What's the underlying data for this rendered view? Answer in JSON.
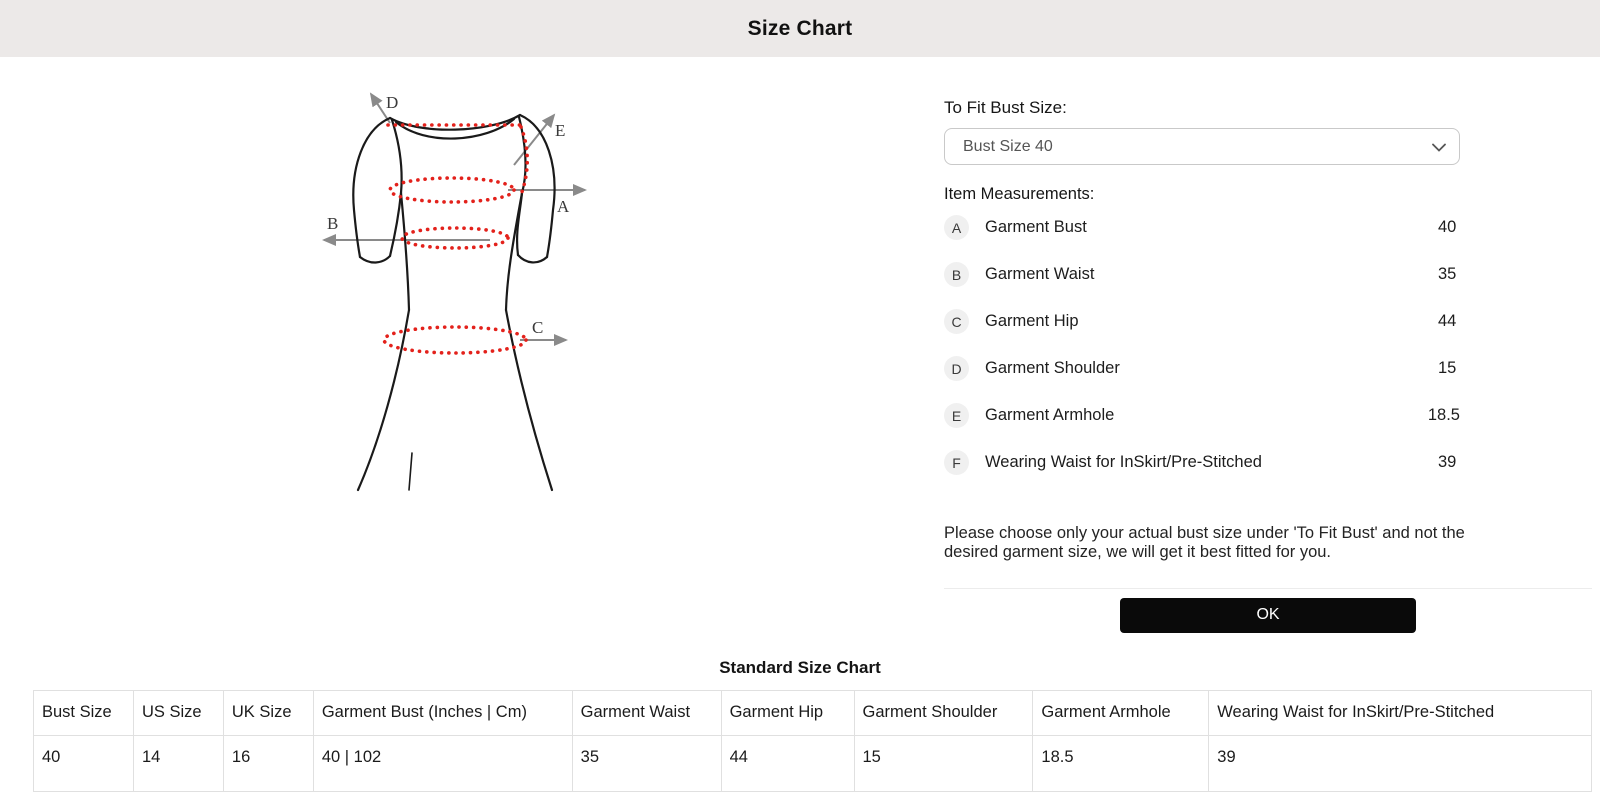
{
  "header": {
    "title": "Size Chart"
  },
  "panel": {
    "to_fit_label": "To Fit Bust Size:",
    "bust_select": {
      "selected": "Bust Size 40"
    },
    "item_measurements_label": "Item Measurements:",
    "measurements": [
      {
        "key": "A",
        "label": "Garment Bust",
        "value": "40"
      },
      {
        "key": "B",
        "label": "Garment Waist",
        "value": "35"
      },
      {
        "key": "C",
        "label": "Garment Hip",
        "value": "44"
      },
      {
        "key": "D",
        "label": "Garment Shoulder",
        "value": "15"
      },
      {
        "key": "E",
        "label": "Garment Armhole",
        "value": "18.5"
      },
      {
        "key": "F",
        "label": "Wearing Waist for InSkirt/Pre-Stitched",
        "value": "39"
      }
    ],
    "note": "Please choose only your actual bust size under 'To Fit Bust' and not the desired garment size, we will get it best fitted for you.",
    "ok_label": "OK"
  },
  "diagram": {
    "arrow_labels": {
      "a": "A",
      "b": "B",
      "c": "C",
      "d": "D",
      "e": "E"
    }
  },
  "size_chart": {
    "title": "Standard Size Chart",
    "columns": [
      "Bust Size",
      "US Size",
      "UK Size",
      "Garment Bust (Inches | Cm)",
      "Garment Waist",
      "Garment Hip",
      "Garment Shoulder",
      "Garment Armhole",
      "Wearing Waist for InSkirt/Pre-Stitched"
    ],
    "rows": [
      [
        "40",
        "14",
        "16",
        "40 | 102",
        "35",
        "44",
        "15",
        "18.5",
        "39"
      ]
    ]
  },
  "colors": {
    "header_bg": "#ECE9E8",
    "button_bg": "#0A0A0A",
    "dot_red": "#E3211B",
    "arrow_gray": "#8A8A8A",
    "table_border": "#E0E0E0"
  }
}
